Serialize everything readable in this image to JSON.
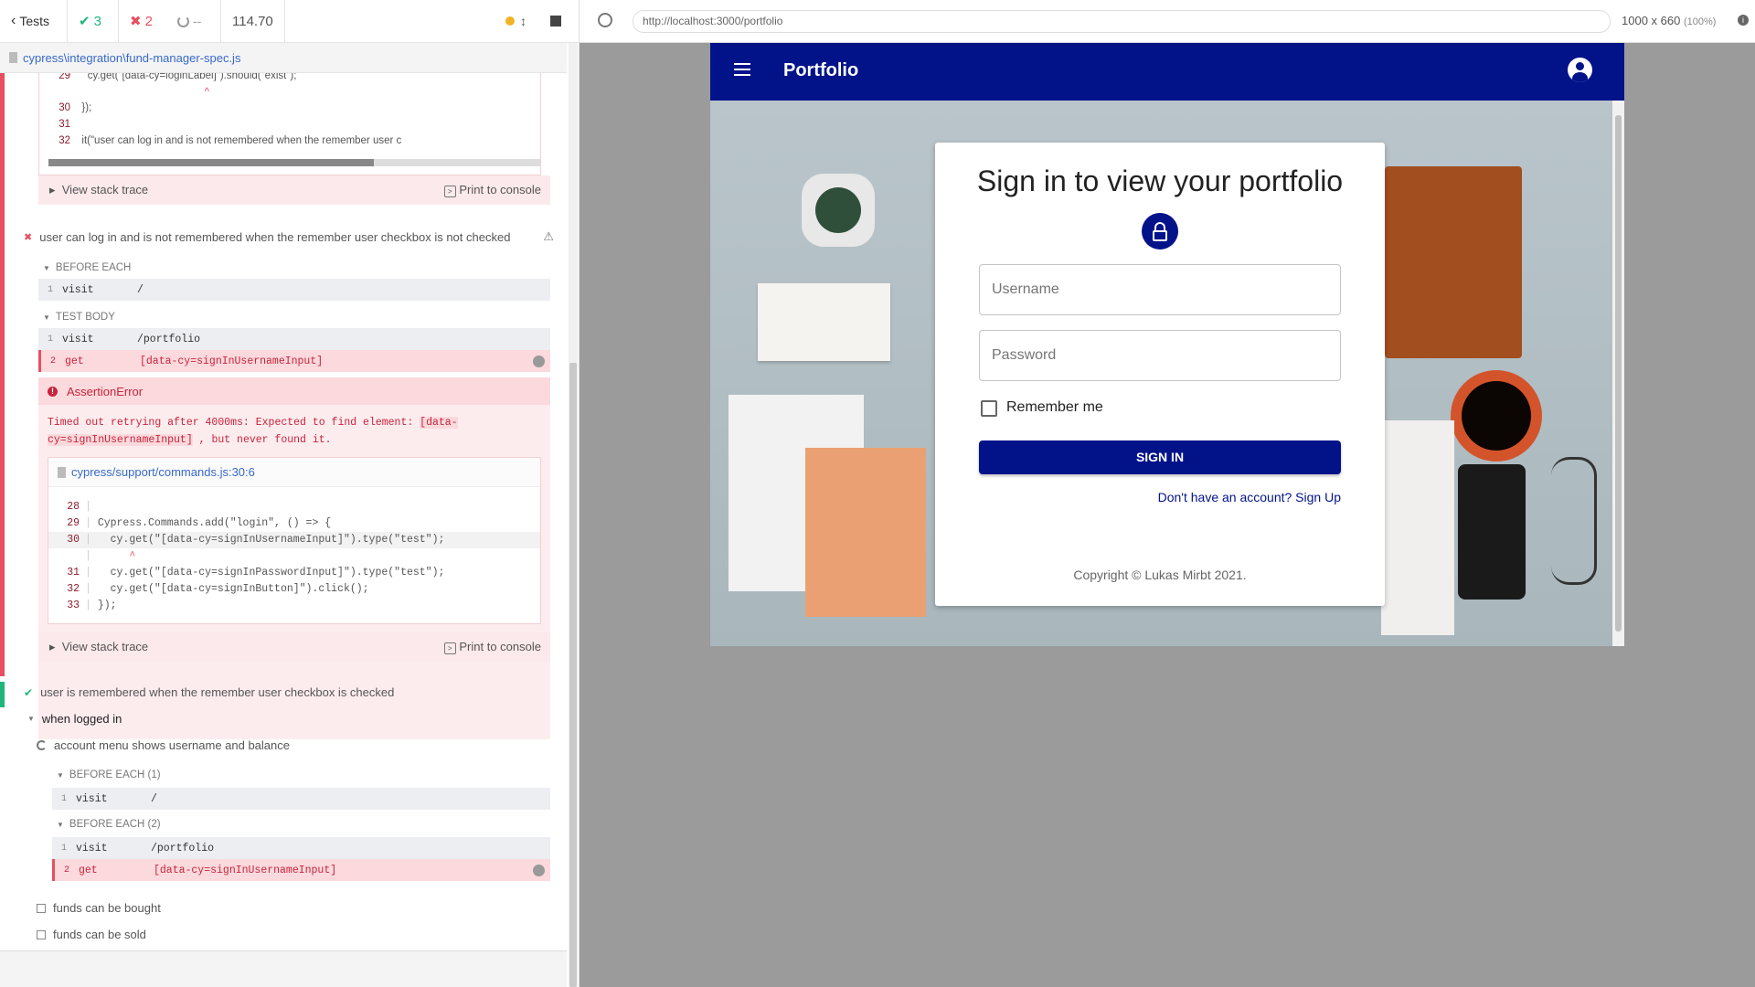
{
  "topbar": {
    "tests_label": "Tests",
    "passed": "3",
    "failed": "2",
    "pending": "--",
    "duration": "114.70"
  },
  "spec": {
    "path": "cypress\\integration\\fund-manager-spec.js"
  },
  "error1": {
    "code": [
      {
        "num": "29",
        "text": "    cy.get(\"[data-cy=loginLabel]\").should(\"exist\");"
      },
      {
        "num": "",
        "text": "                                            ^"
      },
      {
        "num": "30",
        "text": "  });"
      },
      {
        "num": "31",
        "text": ""
      },
      {
        "num": "32",
        "text": "  it(\"user can log in and is not remembered when the remember user c"
      }
    ],
    "view_stack": "View stack trace",
    "print": "Print to console"
  },
  "test2": {
    "title": "user can log in and is not remembered when the remember user checkbox is not checked",
    "before_each": "BEFORE EACH",
    "be_cmd": {
      "num": "1",
      "name": "visit",
      "arg": "/"
    },
    "test_body": "TEST BODY",
    "tb_cmds": [
      {
        "num": "1",
        "name": "visit",
        "arg": "/portfolio"
      },
      {
        "num": "2",
        "name": "get",
        "arg": "[data-cy=signInUsernameInput]"
      }
    ],
    "error_title": "AssertionError",
    "error_msg_1": "Timed out retrying after 4000ms: Expected to find element: ",
    "error_selector_1": "[data-",
    "error_selector_2": "cy=signInUsernameInput]",
    "error_msg_2": " , but never found it.",
    "file_link": "cypress/support/commands.js:30:6",
    "code": [
      {
        "num": "28",
        "text": ""
      },
      {
        "num": "29",
        "text": "Cypress.Commands.add(\"login\", () => {"
      },
      {
        "num": "30",
        "text": "  cy.get(\"[data-cy=signInUsernameInput]\").type(\"test\");"
      },
      {
        "num": "",
        "text": "     ^"
      },
      {
        "num": "31",
        "text": "  cy.get(\"[data-cy=signInPasswordInput]\").type(\"test\");"
      },
      {
        "num": "32",
        "text": "  cy.get(\"[data-cy=signInButton]\").click();"
      },
      {
        "num": "33",
        "text": "});"
      }
    ],
    "view_stack": "View stack trace",
    "print": "Print to console"
  },
  "test3": {
    "title": "user is remembered when the remember user checkbox is checked"
  },
  "suite": {
    "title": "when logged in",
    "running_test": "account menu shows username and balance",
    "before_each_1": "BEFORE EACH (1)",
    "be1_cmd": {
      "num": "1",
      "name": "visit",
      "arg": "/"
    },
    "before_each_2": "BEFORE EACH (2)",
    "be2_cmds": [
      {
        "num": "1",
        "name": "visit",
        "arg": "/portfolio"
      },
      {
        "num": "2",
        "name": "get",
        "arg": "[data-cy=signInUsernameInput]"
      }
    ],
    "pending": [
      "funds can be bought",
      "funds can be sold"
    ]
  },
  "browser": {
    "url": "http://localhost:3000/portfolio",
    "size": "1000 x 660",
    "zoom": "(100%)"
  },
  "app": {
    "title": "Portfolio",
    "signin_title": "Sign in to view your portfolio",
    "username_placeholder": "Username",
    "password_placeholder": "Password",
    "remember_label": "Remember me",
    "signin_button": "SIGN IN",
    "signup_link": "Don't have an account? Sign Up",
    "copyright": "Copyright © Lukas Mirbt 2021."
  },
  "colors": {
    "appbar": "#02138a",
    "fail": "#e94f5f",
    "pass": "#1fb77c",
    "link": "#3869c9"
  }
}
